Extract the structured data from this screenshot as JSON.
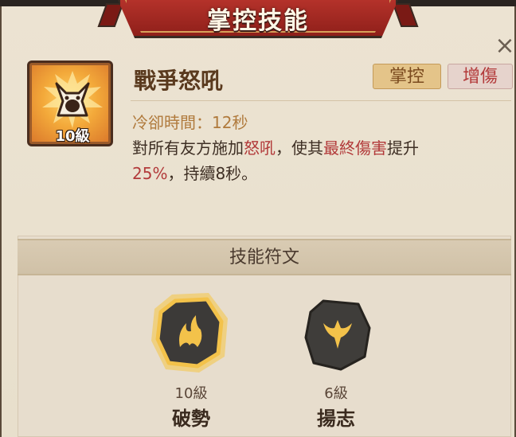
{
  "dialog": {
    "title": "掌控技能",
    "close_symbol": "×"
  },
  "skill": {
    "name": "戰爭怒吼",
    "level_text": "10級",
    "icon": "war-cry-fox-icon",
    "tags": [
      {
        "label": "掌控",
        "color": "#7a4a1e"
      },
      {
        "label": "增傷",
        "color": "#b33a3a"
      }
    ],
    "cooldown_text": "冷卻時間：12秒",
    "description": {
      "part1": "對所有友方施加",
      "buff_name": "怒吼",
      "part2": "，使其",
      "effect": "最終傷害",
      "part3": "提升",
      "value": "25%",
      "part4": "，持續8秒。"
    }
  },
  "runes": {
    "section_title": "技能符文",
    "items": [
      {
        "name": "破勢",
        "level_text": "10級",
        "icon": "flame-claw-rune-icon",
        "highlighted": true
      },
      {
        "name": "揚志",
        "level_text": "6級",
        "icon": "flag-crest-rune-icon",
        "highlighted": false
      }
    ]
  },
  "colors": {
    "banner_red": "#a2271f",
    "accent_red": "#b23a3a",
    "gold": "#f3c24a"
  }
}
